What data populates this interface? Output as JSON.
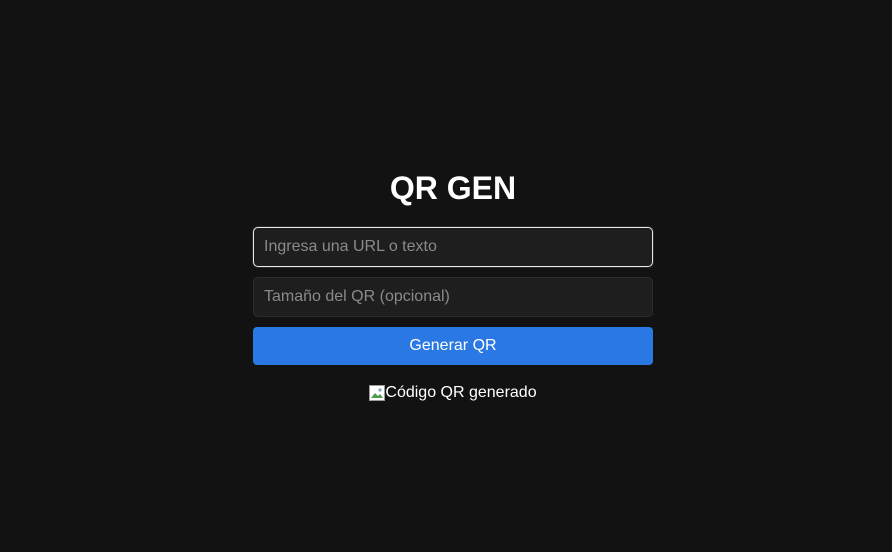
{
  "app": {
    "title": "QR GEN"
  },
  "form": {
    "url_placeholder": "Ingresa una URL o texto",
    "url_value": "",
    "size_placeholder": "Tamaño del QR (opcional)",
    "size_value": "",
    "generate_label": "Generar QR"
  },
  "result": {
    "alt_text": "Código QR generado",
    "icon": "broken-image-icon"
  },
  "colors": {
    "background": "#121212",
    "input_background": "#1e1e1e",
    "button": "#2a78e4",
    "text": "#ffffff"
  }
}
